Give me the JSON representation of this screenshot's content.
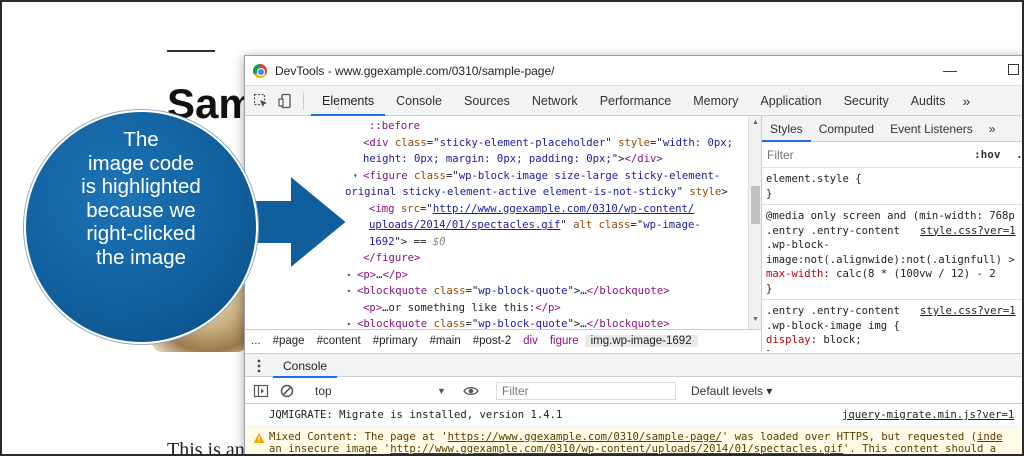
{
  "background_page": {
    "title": "Sam",
    "body_text": "This is an"
  },
  "devtools": {
    "window_title": "DevTools - www.ggexample.com/0310/sample-page/",
    "main_tabs": [
      "Elements",
      "Console",
      "Sources",
      "Network",
      "Performance",
      "Memory",
      "Application",
      "Security",
      "Audits"
    ],
    "more_tabs": "»",
    "elements": {
      "lines": [
        {
          "indent": 24,
          "html": "<span class='pseudo'>::before</span>"
        },
        {
          "indent": 18,
          "html": "<span class='tag'>&lt;div</span> <span class='attr'>class</span>=\"<span class='val'>sticky-element-placeholder</span>\" <span class='attr'>style</span>=\"<span class='val'>width: 0px;</span>"
        },
        {
          "indent": 18,
          "html": "<span class='val'>height: 0px; margin: 0px; padding: 0px;</span>\"&gt;<span class='tag'>&lt;/div&gt;</span>"
        },
        {
          "indent": 18,
          "tri": "▾",
          "html": "<span class='tag'>&lt;figure</span> <span class='attr'>class</span>=\"<span class='val'>wp-block-image size-large sticky-element-</span>"
        },
        {
          "indent": 0,
          "html": "<span class='val'>original sticky-element-active element-is-not-sticky</span>\" <span class='attr'>style</span>&gt;"
        },
        {
          "indent": 24,
          "selected": true,
          "html": "<span class='tag'>&lt;img</span> <span class='attr'>src</span>=\"<span class='link'>http://www.ggexample.com/0310/wp-content/</span>"
        },
        {
          "indent": 24,
          "selected": true,
          "html": "<span class='link'>uploads/2014/01/spectacles.gif</span>\" <span class='attr'>alt</span> <span class='attr'>class</span>=\"<span class='val'>wp-image-</span>"
        },
        {
          "indent": 24,
          "selected": true,
          "html": "<span class='val'>1692</span>\"&gt; == <span class='dim'>$0</span>"
        },
        {
          "indent": 18,
          "html": "<span class='tag'>&lt;/figure&gt;</span>"
        },
        {
          "indent": 12,
          "tri": "▸",
          "html": "<span class='tag'>&lt;p&gt;</span>…<span class='tag'>&lt;/p&gt;</span>"
        },
        {
          "indent": 12,
          "tri": "▸",
          "html": "<span class='tag'>&lt;blockquote</span> <span class='attr'>class</span>=\"<span class='val'>wp-block-quote</span>\"&gt;…<span class='tag'>&lt;/blockquote&gt;</span>"
        },
        {
          "indent": 18,
          "html": "<span class='tag'>&lt;p&gt;</span>…or something like this:<span class='tag'>&lt;/p&gt;</span>"
        },
        {
          "indent": 12,
          "tri": "▸",
          "html": "<span class='tag'>&lt;blockquote</span> <span class='attr'>class</span>=\"<span class='val'>wp-block-quote</span>\"&gt;…<span class='tag'>&lt;/blockquote&gt;</span>"
        }
      ]
    },
    "breadcrumbs": [
      "...",
      "#page",
      "#content",
      "#primary",
      "#main",
      "#post-2",
      "div",
      "figure",
      "img.wp-image-1692"
    ],
    "styles": {
      "tabs": [
        "Styles",
        "Computed",
        "Event Listeners",
        "»"
      ],
      "filter_placeholder": "Filter",
      "hov": ":hov",
      "cls": ".cl",
      "rules": [
        {
          "line": "element.style {"
        },
        {
          "line": "}"
        },
        {
          "divider": true
        },
        {
          "line": "@media only screen and (min-width: 768p"
        },
        {
          "line": ".entry .entry-content",
          "src": "style.css?ver=1"
        },
        {
          "line": ".wp-block-"
        },
        {
          "line": "image:not(.alignwide):not(.alignfull) >"
        },
        {
          "line": "  <span class='prop'>max-width</span>: calc(8 * (100vw / 12) - 2"
        },
        {
          "line": "}"
        },
        {
          "divider": true
        },
        {
          "line": ".entry .entry-content",
          "src": "style.css?ver=1"
        },
        {
          "line": ".wp-block-image img {"
        },
        {
          "line": "  <span class='prop'>display</span>: block;"
        },
        {
          "line": "}"
        }
      ]
    },
    "console": {
      "drawer_tab": "Console",
      "context": "top",
      "filter_placeholder": "Filter",
      "levels": "Default levels ▾",
      "messages": [
        {
          "type": "log",
          "text": "JQMIGRATE: Migrate is installed, version 1.4.1",
          "source": "jquery-migrate.min.js?ver=1"
        },
        {
          "type": "warn",
          "html": "Mixed Content: The page at '<span class='link-u'>https://www.ggexample.com/0310/sample-page/</span>' was loaded over HTTPS, but requested (<span class='link-u'>inde</span><br>an insecure image '<span class='link-u'>http://www.ggexample.com/0310/wp-content/uploads/2014/01/spectacles.gif</span>'. This content should a"
        }
      ]
    }
  },
  "callout": {
    "lines": [
      "The",
      "image code",
      "is highlighted",
      "because we",
      "right-clicked",
      "the image"
    ],
    "color": "#105e9c"
  }
}
